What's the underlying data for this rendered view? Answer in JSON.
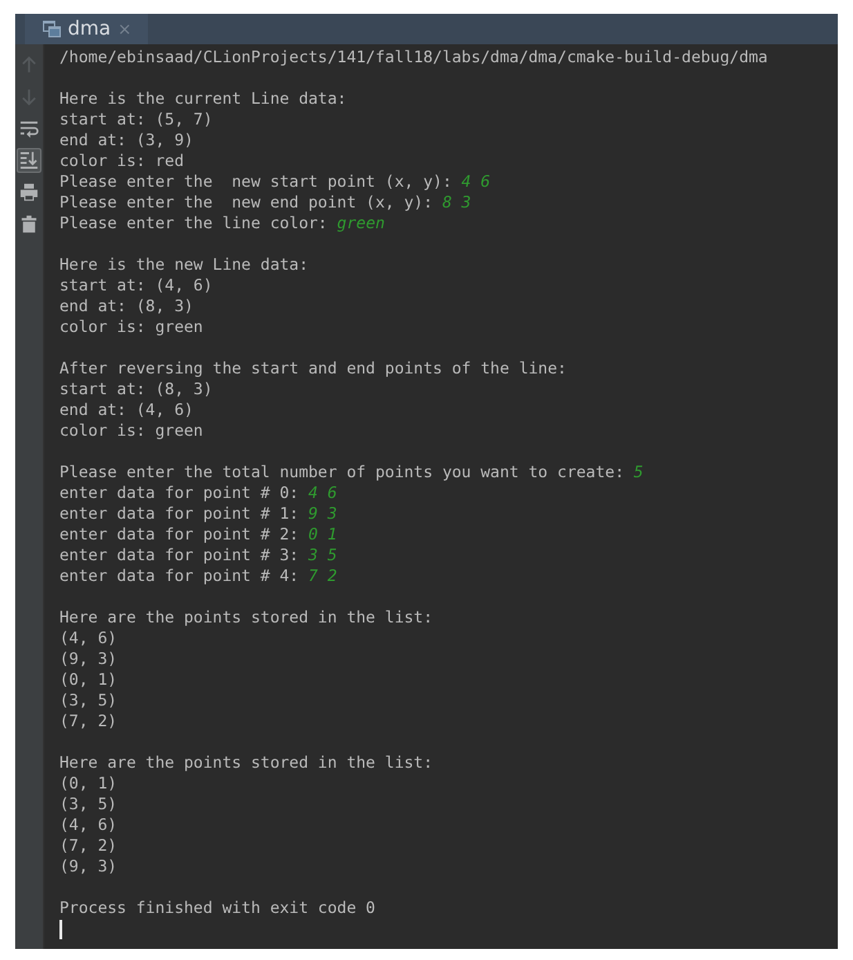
{
  "tab": {
    "label": "dma",
    "close": "×"
  },
  "toolbar": [
    {
      "disabled": true,
      "on": false
    },
    {
      "disabled": true,
      "on": false
    },
    {
      "disabled": false,
      "on": false
    },
    {
      "disabled": false,
      "on": true
    },
    {
      "disabled": false,
      "on": false
    },
    {
      "disabled": false,
      "on": false
    }
  ],
  "console": {
    "blocks": [
      {
        "lines": [
          {
            "text": "/home/ebinsaad/CLionProjects/141/fall18/labs/dma/dma/cmake-build-debug/dma"
          }
        ]
      },
      {
        "lines": [
          {
            "text": "Here is the current Line data:"
          },
          {
            "text": "start at: (5, 7)"
          },
          {
            "text": "end at: (3, 9)"
          },
          {
            "text": "color is: red"
          },
          {
            "text": "Please enter the  new start point (x, y):",
            "input": "4 6"
          },
          {
            "text": "Please enter the  new end point (x, y):",
            "input": "8 3"
          },
          {
            "text": "Please enter the line color:",
            "input": "green"
          }
        ]
      },
      {
        "lines": [
          {
            "text": "Here is the new Line data:"
          },
          {
            "text": "start at: (4, 6)"
          },
          {
            "text": "end at: (8, 3)"
          },
          {
            "text": "color is: green"
          }
        ]
      },
      {
        "lines": [
          {
            "text": "After reversing the start and end points of the line:"
          },
          {
            "text": "start at: (8, 3)"
          },
          {
            "text": "end at: (4, 6)"
          },
          {
            "text": "color is: green"
          }
        ]
      },
      {
        "lines": [
          {
            "text": "Please enter the total number of points you want to create:",
            "input": "5"
          },
          {
            "text": "enter data for point # 0:",
            "input": "4 6"
          },
          {
            "text": "enter data for point # 1:",
            "input": "9 3"
          },
          {
            "text": "enter data for point # 2:",
            "input": "0 1"
          },
          {
            "text": "enter data for point # 3:",
            "input": "3 5"
          },
          {
            "text": "enter data for point # 4:",
            "input": "7 2"
          }
        ]
      },
      {
        "lines": [
          {
            "text": "Here are the points stored in the list:"
          },
          {
            "text": "(4, 6)"
          },
          {
            "text": "(9, 3)"
          },
          {
            "text": "(0, 1)"
          },
          {
            "text": "(3, 5)"
          },
          {
            "text": "(7, 2)"
          }
        ]
      },
      {
        "lines": [
          {
            "text": "Here are the points stored in the list:"
          },
          {
            "text": "(0, 1)"
          },
          {
            "text": "(3, 5)"
          },
          {
            "text": "(4, 6)"
          },
          {
            "text": "(7, 2)"
          },
          {
            "text": "(9, 3)"
          }
        ]
      },
      {
        "lines": [
          {
            "text": "Process finished with exit code 0"
          }
        ]
      }
    ]
  }
}
